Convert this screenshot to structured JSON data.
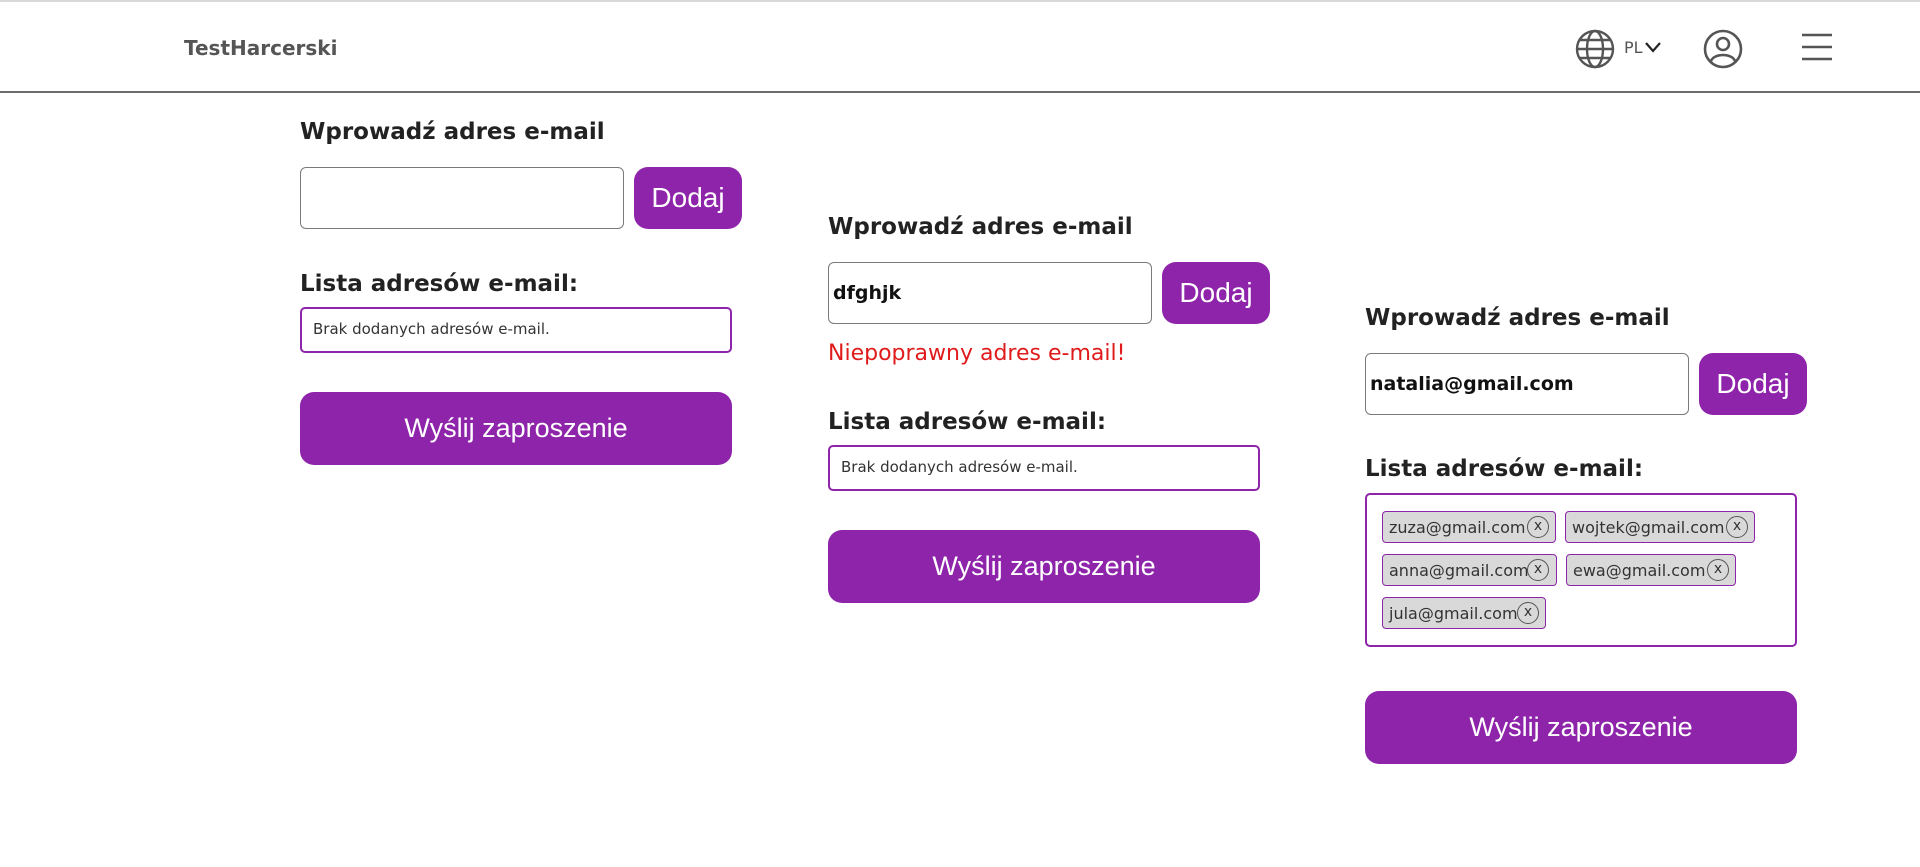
{
  "app": {
    "brand": "TestHarcerski"
  },
  "header": {
    "language": "PL"
  },
  "form": {
    "input_label": "Wprowadź adres e-mail",
    "add_label": "Dodaj",
    "list_label": "Lista adresów e-mail:",
    "empty_list_text": "Brak dodanych adresów e-mail.",
    "send_label": "Wyślij zaproszenie"
  },
  "panels": [
    {
      "input_value": ""
    },
    {
      "input_value": "dfghjk",
      "error": "Niepoprawny adres e-mail!"
    },
    {
      "input_value": "natalia@gmail.com",
      "emails": [
        "zuza@gmail.com",
        "wojtek@gmail.com",
        "anna@gmail.com",
        "ewa@gmail.com",
        "jula@gmail.com"
      ],
      "remove_label": "x"
    }
  ],
  "colors": {
    "accent": "#8e24aa",
    "error": "#e01b1b",
    "chip_bg": "#d9d9d9"
  },
  "icons": {
    "language": "globe-icon",
    "dropdown": "chevron-down-icon",
    "account": "user-icon",
    "menu": "hamburger-menu-icon"
  }
}
